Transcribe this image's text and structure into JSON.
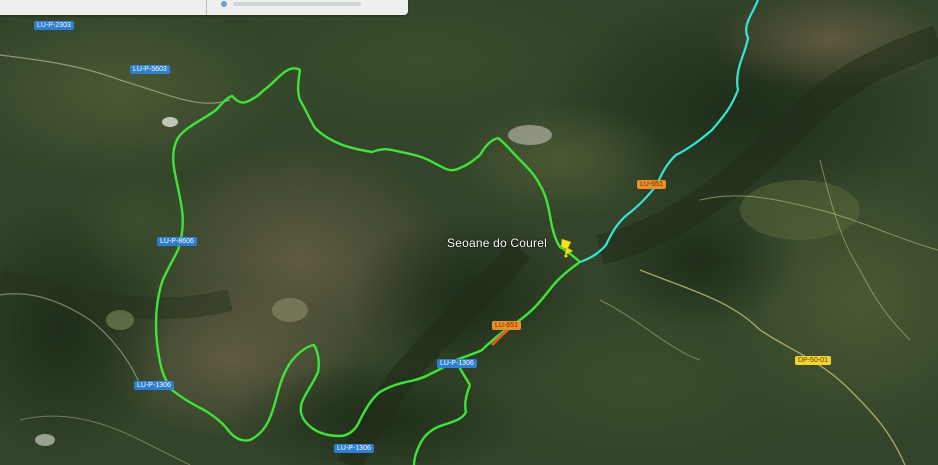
{
  "map": {
    "type": "satellite",
    "place_label": "Seoane do Courel",
    "colors": {
      "route": "#3fe33a",
      "river": "#34e6d6",
      "highlight_segment": "#e8542a",
      "pin": "#f6e21a",
      "minor_road": "#c9c280"
    },
    "road_labels": [
      {
        "id": "lup2303",
        "text": "LU-P-2303",
        "style": "blue"
      },
      {
        "id": "lup5603",
        "text": "LU-P-5603",
        "style": "blue"
      },
      {
        "id": "lup8606",
        "text": "LU-P-8606",
        "style": "blue"
      },
      {
        "id": "lup1306a",
        "text": "LU-P-1306",
        "style": "blue"
      },
      {
        "id": "lup1306b",
        "text": "LU-P-1306",
        "style": "blue"
      },
      {
        "id": "lup1306c",
        "text": "LU-P-1306",
        "style": "blue"
      },
      {
        "id": "lu651a",
        "text": "LU-651",
        "style": "orange"
      },
      {
        "id": "lu651b",
        "text": "LU-651",
        "style": "orange"
      },
      {
        "id": "dp5001",
        "text": "DP-50-01",
        "style": "yellow"
      }
    ],
    "top_bar": {
      "icon": "map-pin-icon"
    }
  }
}
